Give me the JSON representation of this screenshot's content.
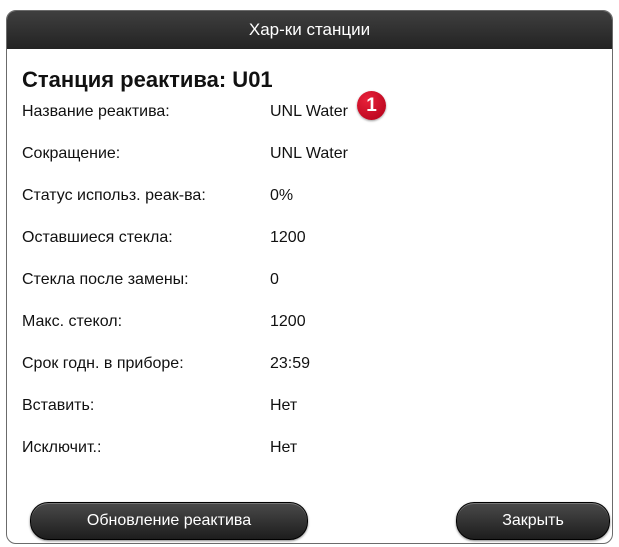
{
  "dialog": {
    "title": "Хар-ки станции",
    "heading": "Станция реактива: U01",
    "callout": "1"
  },
  "properties": [
    {
      "label": "Название реактива:",
      "value": "UNL Water"
    },
    {
      "label": "Сокращение:",
      "value": "UNL Water"
    },
    {
      "label": "Статус использ. реак-ва:",
      "value": "0%"
    },
    {
      "label": "Оставшиеся стекла:",
      "value": "1200"
    },
    {
      "label": "Стекла после замены:",
      "value": "0"
    },
    {
      "label": "Макс. стекол:",
      "value": "1200"
    },
    {
      "label": "Срок годн. в приборе:",
      "value": "23:59"
    },
    {
      "label": "Вставить:",
      "value": "Нет"
    },
    {
      "label": "Исключит.:",
      "value": "Нет"
    }
  ],
  "buttons": {
    "update_label": "Обновление реактива",
    "close_label": "Закрыть"
  },
  "colors": {
    "titlebar": "#2e2e2e",
    "callout": "#d0102a",
    "button": "#2a2a2a"
  }
}
